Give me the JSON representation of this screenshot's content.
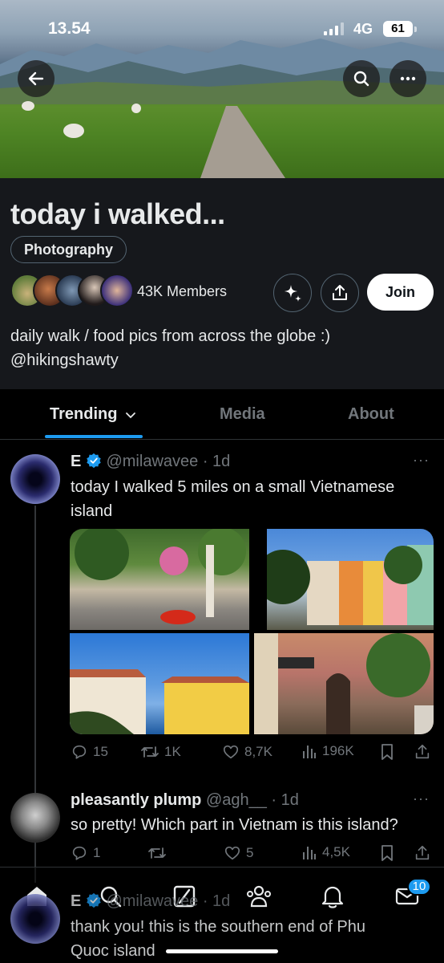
{
  "status_bar": {
    "time": "13.54",
    "network": "4G",
    "battery": "61"
  },
  "community": {
    "title": "today i walked...",
    "category": "Photography",
    "members": "43K Members",
    "join_label": "Join",
    "description_line1": "daily walk / food pics from across the globe :)",
    "description_line2": "@hikingshawty"
  },
  "tabs": [
    {
      "label": "Trending"
    },
    {
      "label": "Media"
    },
    {
      "label": "About"
    }
  ],
  "posts": [
    {
      "name": "E",
      "handle": "@milawavee",
      "time": "· 1d",
      "text_line1": "today I walked 5 miles on a small Vietnamese",
      "text_line2": "island",
      "replies": "15",
      "reposts": "1K",
      "likes": "8,7K",
      "views": "196K"
    },
    {
      "name": "pleasantly plump",
      "handle": "@agh__",
      "time": "· 1d",
      "text_line1": "so pretty! Which part in Vietnam is this island?",
      "replies": "1",
      "reposts": "",
      "likes": "5",
      "views": "4,5K"
    },
    {
      "name": "E",
      "handle": "@milawavee",
      "time": "· 1d",
      "text_line1": "thank you! this is the southern end of Phu",
      "text_line2": "Quoc island"
    }
  ],
  "bottom_nav": {
    "messages_badge": "10"
  },
  "colors": {
    "accent": "#1d9bf0",
    "background": "#000000",
    "panel": "#16181c"
  }
}
